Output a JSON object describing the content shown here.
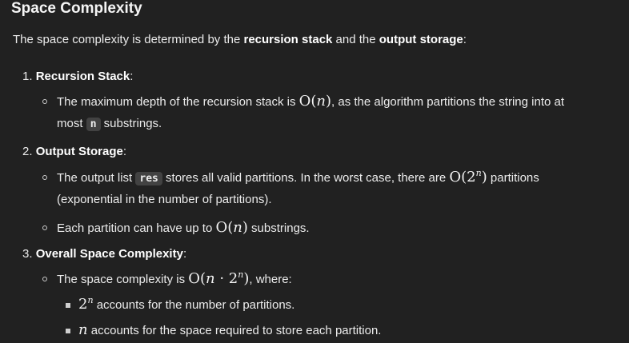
{
  "heading": "Space Complexity",
  "intro": {
    "pre": "The space complexity is determined by the ",
    "bold1": "recursion stack",
    "mid": " and the ",
    "bold2": "output storage",
    "post": ":"
  },
  "items": [
    {
      "number": "1.",
      "title": "Recursion Stack",
      "colon": ":",
      "bullets": [
        {
          "pre": "The maximum depth of the recursion stack is ",
          "math": "O(n)",
          "post": ", as the algorithm partitions the string into at",
          "line2_pre": "most ",
          "code": "n",
          "line2_post": " substrings."
        }
      ]
    },
    {
      "number": "2.",
      "title": "Output Storage",
      "colon": ":",
      "bullets": [
        {
          "pre": "The output list ",
          "code": "res",
          "mid": " stores all valid partitions. In the worst case, there are ",
          "math": "O(2^n)",
          "post": " partitions",
          "line2": "(exponential in the number of partitions)."
        },
        {
          "pre": "Each partition can have up to ",
          "math": "O(n)",
          "post": " substrings."
        }
      ]
    },
    {
      "number": "3.",
      "title": "Overall Space Complexity",
      "colon": ":",
      "bullets": [
        {
          "pre": "The space complexity is ",
          "math": "O(n · 2^n)",
          "post": ", where:",
          "subbullets": [
            {
              "math": "2^n",
              "text": " accounts for the number of partitions."
            },
            {
              "math": "n",
              "text": " accounts for the space required to store each partition."
            }
          ]
        }
      ]
    }
  ]
}
